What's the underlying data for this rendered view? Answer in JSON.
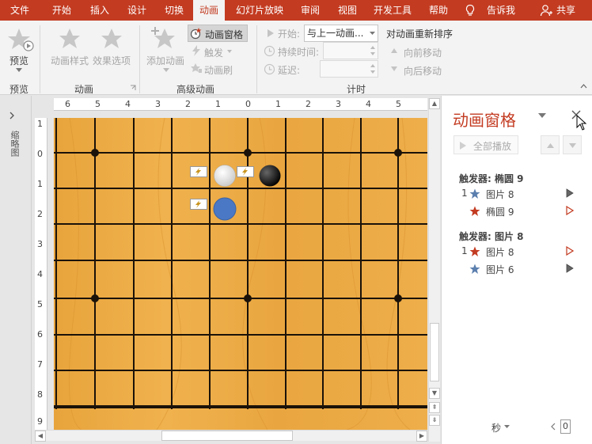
{
  "tabs": [
    "文件",
    "开始",
    "插入",
    "设计",
    "切换",
    "动画",
    "幻灯片放映",
    "审阅",
    "视图",
    "开发工具",
    "帮助",
    "告诉我",
    "共享"
  ],
  "active_tab": "动画",
  "ribbon": {
    "preview": {
      "button": "预览",
      "group": "预览"
    },
    "animation": {
      "style": "动画样式",
      "effect_options": "效果选项",
      "group": "动画"
    },
    "advanced": {
      "add": "添加动画",
      "pane": "动画窗格",
      "trigger": "触发",
      "painter": "动画刷",
      "group": "高级动画"
    },
    "timing": {
      "start_label": "开始:",
      "start_value": "与上一动画...",
      "duration_label": "持续时间:",
      "delay_label": "延迟:",
      "reorder_title": "对动画重新排序",
      "move_earlier": "向前移动",
      "move_later": "向后移动",
      "group": "计时"
    }
  },
  "left_panel": {
    "label": "缩略图"
  },
  "h_ruler": [
    "6",
    "5",
    "4",
    "3",
    "2",
    "1",
    "0",
    "1",
    "2",
    "3",
    "4",
    "5"
  ],
  "v_ruler": [
    "1",
    "0",
    "1",
    "2",
    "3",
    "4",
    "5",
    "6",
    "7",
    "8",
    "9"
  ],
  "pane": {
    "title": "动画窗格",
    "play_all": "全部播放",
    "groups": [
      {
        "trigger": "触发器: 椭圆 9",
        "items": [
          {
            "index": "1",
            "name": "图片 8",
            "star": "blue-star",
            "color": "#4a76a8"
          },
          {
            "index": "",
            "name": "椭圆 9",
            "star": "orange-star",
            "color": "#c33b21"
          }
        ]
      },
      {
        "trigger": "触发器: 图片 8",
        "items": [
          {
            "index": "1",
            "name": "图片 8",
            "star": "orange-star",
            "color": "#c33b21"
          },
          {
            "index": "",
            "name": "图片 6",
            "star": "blue-star",
            "color": "#4a76a8"
          }
        ]
      }
    ],
    "time_unit": "秒",
    "zoom_value": "0"
  },
  "colors": {
    "accent": "#c33b21",
    "board": "#e9a63f",
    "stone_blue": "#4a78c4"
  }
}
